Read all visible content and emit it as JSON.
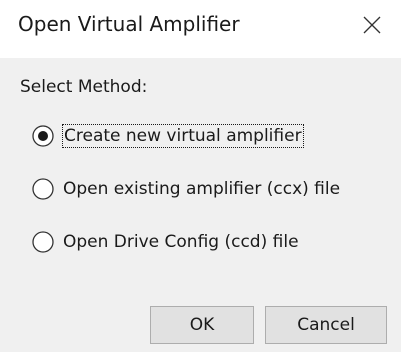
{
  "window": {
    "title": "Open Virtual Amplifier",
    "close_icon": "close-icon"
  },
  "method_group": {
    "label": "Select Method:",
    "options": [
      {
        "label": "Create new virtual amplifier",
        "selected": true
      },
      {
        "label": "Open existing amplifier (ccx) file",
        "selected": false
      },
      {
        "label": "Open Drive Config (ccd) file",
        "selected": false
      }
    ]
  },
  "buttons": {
    "ok_label": "OK",
    "cancel_label": "Cancel"
  },
  "colors": {
    "dialog_background": "#f0f0f0",
    "titlebar_background": "#ffffff",
    "button_background": "#e1e1e1",
    "button_border": "#adadad",
    "text": "#1a1a1a"
  }
}
